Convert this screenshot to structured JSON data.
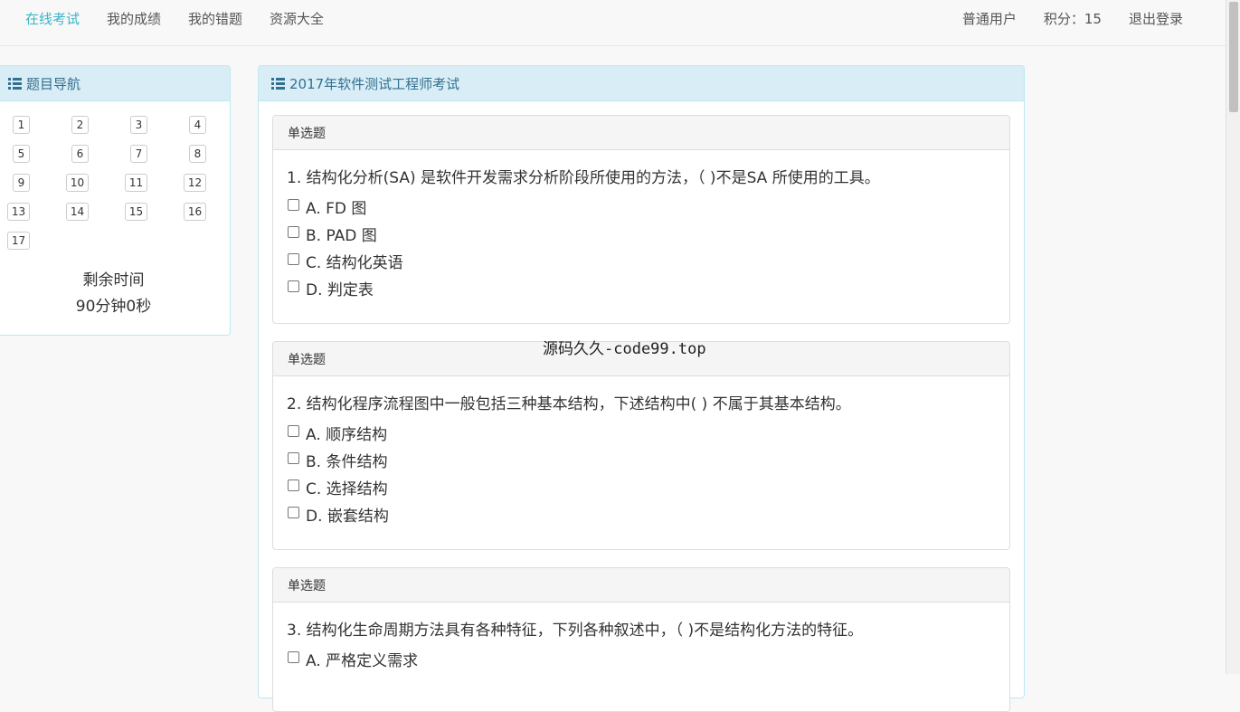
{
  "navbar": {
    "left_links": [
      {
        "label": "在线考试",
        "active": true
      },
      {
        "label": "我的成绩",
        "active": false
      },
      {
        "label": "我的错题",
        "active": false
      },
      {
        "label": "资源大全",
        "active": false
      }
    ],
    "user_role": "普通用户",
    "points": "积分：15",
    "logout": "退出登录"
  },
  "question_nav": {
    "title": "题目导航",
    "icon": "list-icon",
    "numbers": [
      "1",
      "2",
      "3",
      "4",
      "5",
      "6",
      "7",
      "8",
      "9",
      "10",
      "11",
      "12",
      "13",
      "14",
      "15",
      "16",
      "17"
    ],
    "remaining_label": "剩余时间",
    "remaining_value": "90分钟0秒"
  },
  "exam": {
    "title": "2017年软件测试工程师考试",
    "icon": "list-icon",
    "questions": [
      {
        "type": "单选题",
        "text": "1. 结构化分析(SA) 是软件开发需求分析阶段所使用的方法，（ )不是SA 所使用的工具。",
        "options": [
          "A. FD 图",
          "B. PAD 图",
          "C. 结构化英语",
          "D. 判定表"
        ]
      },
      {
        "type": "单选题",
        "text": "2. 结构化程序流程图中一般包括三种基本结构，下述结构中( ) 不属于其基本结构。",
        "options": [
          "A. 顺序结构",
          "B. 条件结构",
          "C. 选择结构",
          "D. 嵌套结构"
        ]
      },
      {
        "type": "单选题",
        "text": "3. 结构化生命周期方法具有各种特征，下列各种叙述中，（ )不是结构化方法的特征。",
        "options": [
          "A. 严格定义需求"
        ]
      }
    ]
  },
  "watermark": {
    "cn": "源码久久",
    "en": "-code99.top"
  },
  "colors": {
    "active_link": "#3bb4c8",
    "panel_heading_bg": "#d9edf7",
    "panel_heading_text": "#31708f",
    "panel_border": "#bce8f1"
  }
}
